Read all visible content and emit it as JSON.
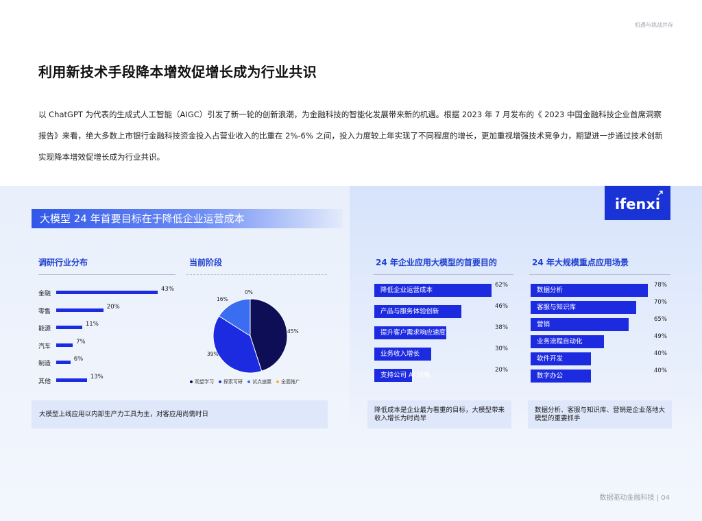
{
  "header": {
    "top_right": "机遇与挑战并存"
  },
  "title": "利用新技术手段降本增效促增长成为行业共识",
  "intro": "以 ChatGPT 为代表的生成式人工智能（AIGC）引发了新一轮的创新浪潮，为金融科技的智能化发展带来新的机遇。根据 2023 年 7 月发布的《 2023 中国金融科技企业首席洞察报告》来看，绝大多数上市银行金融科技资金投入占营业收入的比重在 2%-6% 之间，投入力度较上年实现了不同程度的增长，更加重视增强技术竞争力，期望进一步通过技术创新实现降本增效促增长成为行业共识。",
  "banner": "大模型 24 年首要目标在于降低企业运营成本",
  "logo": {
    "text": "ifenxi",
    "color": "#1933d6"
  },
  "colors": {
    "accent": "#1d2be0",
    "title_blue": "#1f3fcf",
    "navy": "#0d0e55",
    "banner_blue": "#3157e8"
  },
  "industry": {
    "title": "调研行业分布",
    "items": [
      {
        "label": "金融",
        "value": 43,
        "text": "43%"
      },
      {
        "label": "零售",
        "value": 20,
        "text": "20%"
      },
      {
        "label": "能源",
        "value": 11,
        "text": "11%"
      },
      {
        "label": "汽车",
        "value": 7,
        "text": "7%"
      },
      {
        "label": "制造",
        "value": 6,
        "text": "6%"
      },
      {
        "label": "其他",
        "value": 13,
        "text": "13%"
      }
    ]
  },
  "stage": {
    "title": "当前阶段",
    "slices": [
      {
        "name": "观望学习",
        "value": 45,
        "text": "45%",
        "color": "#0d0e55"
      },
      {
        "name": "探索可研",
        "value": 39,
        "text": "39%",
        "color": "#1d2be0"
      },
      {
        "name": "试点速赢",
        "value": 16,
        "text": "16%",
        "color": "#3a6df0"
      },
      {
        "name": "全面推广",
        "value": 0,
        "text": "0%",
        "color": "#f0b23a"
      }
    ]
  },
  "purpose": {
    "title": "24 年企业应用大模型的首要目的",
    "items": [
      {
        "label": "降低企业运营成本",
        "value": 62,
        "text": "62%"
      },
      {
        "label": "产品与服务体验创新",
        "value": 46,
        "text": "46%"
      },
      {
        "label": "提升客户需求响应速度",
        "value": 38,
        "text": "38%"
      },
      {
        "label": "业务收入增长",
        "value": 30,
        "text": "30%"
      },
      {
        "label": "支持公司 AI 战略",
        "value": 20,
        "text": "20%"
      }
    ]
  },
  "scenario": {
    "title": "24 年大规模重点应用场景",
    "items": [
      {
        "label": "数据分析",
        "value": 78,
        "text": "78%"
      },
      {
        "label": "客服与知识库",
        "value": 70,
        "text": "70%"
      },
      {
        "label": "营销",
        "value": 65,
        "text": "65%"
      },
      {
        "label": "业务流程自动化",
        "value": 49,
        "text": "49%"
      },
      {
        "label": "软件开发",
        "value": 40,
        "text": "40%"
      },
      {
        "label": "数字办公",
        "value": 40,
        "text": "40%"
      }
    ]
  },
  "notes": {
    "left": "大模型上线应用以内部生产力工具为主，对客应用尚需时日",
    "middle": "降低成本是企业最为看重的目标，大模型带来收入增长为时尚早",
    "right": "数据分析、客服与知识库、营销是企业落地大模型的重要抓手"
  },
  "footer": "数据驱动金融科技 | 04"
}
